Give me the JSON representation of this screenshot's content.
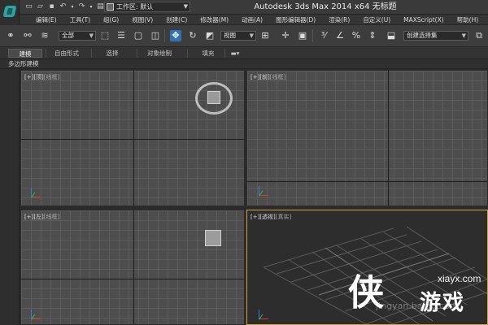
{
  "window": {
    "title": "Autodesk 3ds Max  2014 x64    无标题"
  },
  "title_bar": {
    "workspace_label": "工作区: 默认",
    "quick_access_icons": [
      "new-file-icon",
      "open-folder-icon",
      "save-icon",
      "undo-icon",
      "redo-icon",
      "project-folder-icon"
    ]
  },
  "menu": {
    "items": [
      "编辑(E)",
      "工具(T)",
      "组(G)",
      "视图(V)",
      "创建(C)",
      "修改器(M)",
      "动画(A)",
      "图形编辑器(D)",
      "渲染(R)",
      "自定义(U)",
      "MAXScript(X)",
      "帮助(H)"
    ]
  },
  "toolbar": {
    "selection_filter": "全部",
    "reference_coord": "视图",
    "named_selection_placeholder": "创建选择集"
  },
  "ribbon": {
    "tabs": [
      "建模",
      "自由形式",
      "选择",
      "对象绘制",
      "填充"
    ],
    "active_tab": "建模",
    "panel_label": "多边形建模"
  },
  "viewports": {
    "top": {
      "plus": "[+]",
      "name": "[顶]",
      "shading": "[线框]"
    },
    "front": {
      "plus": "[+]",
      "name": "[前]",
      "shading": "[线框]"
    },
    "left": {
      "plus": "[+]",
      "name": "[左]",
      "shading": "[线框]"
    },
    "perspective": {
      "plus": "[+]",
      "name": "[透视]",
      "shading": "[真实]"
    }
  },
  "watermark": {
    "logo": "侠",
    "site": "xiayx.com",
    "name": "游戏",
    "faint_text": "jingyan.baidu.com"
  },
  "colors": {
    "active_tool": "#2c74b5",
    "active_viewport_border": "#d6a23a",
    "viewport_bg": "#4d4d4d",
    "perspective_bg": "#2d2d2d"
  }
}
